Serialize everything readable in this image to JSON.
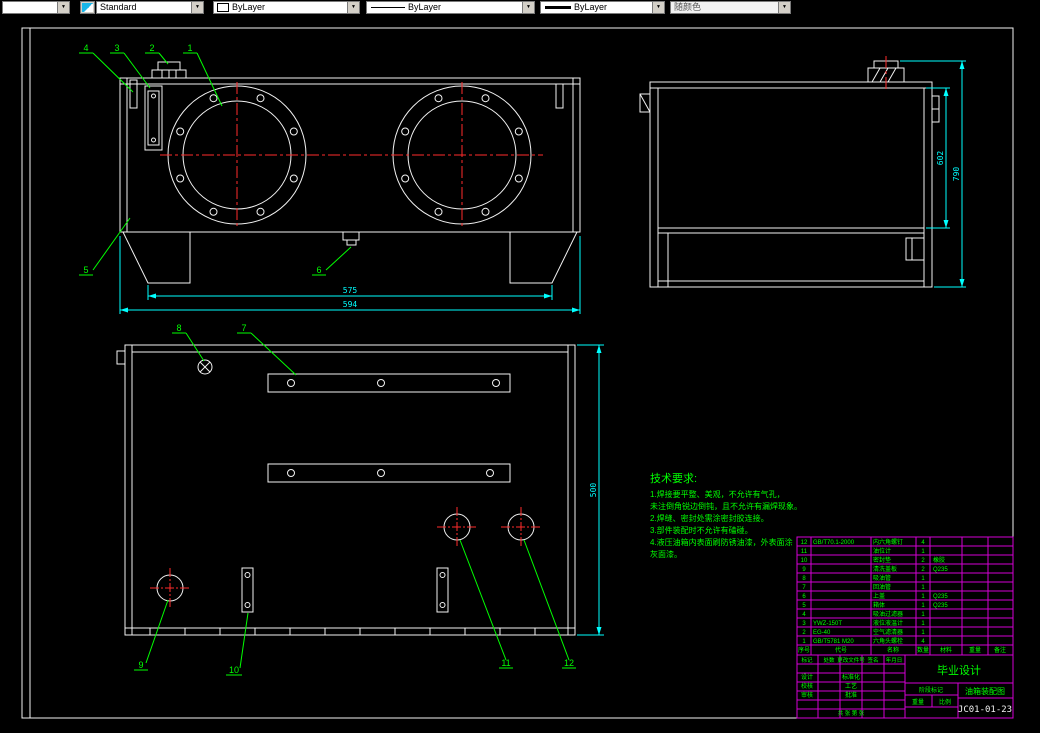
{
  "toolbar": {
    "combos": [
      {
        "value": ""
      },
      {
        "value": "Standard"
      },
      {
        "value": "ByLayer"
      },
      {
        "value": "ByLayer"
      },
      {
        "value": "ByLayer"
      },
      {
        "value": "随颜色"
      }
    ]
  },
  "callouts": [
    "1",
    "2",
    "3",
    "4",
    "5",
    "6",
    "7",
    "8",
    "9",
    "10",
    "11",
    "12"
  ],
  "dims": {
    "front_inner": "575",
    "front_outer": "594",
    "side_inner": "602",
    "side_outer": "790",
    "bottom_height": "500"
  },
  "tech_requirements": {
    "title": "技术要求:",
    "lines": [
      "1.焊接要平整、美观，不允许有气孔，",
      "未注倒角锐边倒钝，且不允许有漏焊现象。",
      "2.焊缝、密封处需涂密封胶连接。",
      "3.部件装配时不允许有磕碰。",
      "4.液压油箱内表面刷防锈油漆，外表面涂",
      "灰面漆。"
    ]
  },
  "title_block": {
    "parts_header": {
      "no": "序号",
      "code": "代号",
      "name": "名称",
      "qty": "数量",
      "material": "材料",
      "weight": "重量",
      "note": "备注"
    },
    "parts": [
      {
        "no": "12",
        "code": "GB/T70.1-2000",
        "name": "内六角螺钉",
        "qty": "4",
        "material": ""
      },
      {
        "no": "11",
        "code": "",
        "name": "油位计",
        "qty": "1",
        "material": ""
      },
      {
        "no": "10",
        "code": "",
        "name": "密封垫",
        "qty": "2",
        "material": "橡胶"
      },
      {
        "no": "9",
        "code": "",
        "name": "清洗盖板",
        "qty": "2",
        "material": "Q235"
      },
      {
        "no": "8",
        "code": "",
        "name": "吸油管",
        "qty": "1",
        "material": ""
      },
      {
        "no": "7",
        "code": "",
        "name": "回油管",
        "qty": "1",
        "material": ""
      },
      {
        "no": "6",
        "code": "",
        "name": "上盖",
        "qty": "1",
        "material": "Q235"
      },
      {
        "no": "5",
        "code": "",
        "name": "箱体",
        "qty": "1",
        "material": "Q235"
      },
      {
        "no": "4",
        "code": "",
        "name": "吸油过滤器",
        "qty": "1",
        "material": ""
      },
      {
        "no": "3",
        "code": "YWZ-150T",
        "name": "液位液温计",
        "qty": "1",
        "material": ""
      },
      {
        "no": "2",
        "code": "EG-40",
        "name": "空气滤清器",
        "qty": "1",
        "material": ""
      },
      {
        "no": "1",
        "code": "GB/T5781 M20",
        "name": "六角头螺栓",
        "qty": "4",
        "material": ""
      }
    ],
    "rev_row": {
      "c0": "标记",
      "c1": "处数",
      "c2": "更改文件号",
      "c3": "签名",
      "c4": "年月日"
    },
    "sig": {
      "design": "设计",
      "standard": "标准化",
      "check": "校核",
      "process": "工艺",
      "audit": "审核",
      "approve": "批准"
    },
    "stage": "阶段标记",
    "weight": "重量",
    "scale": "比例",
    "sheet": "共 张 第 张",
    "project": "毕业设计",
    "drawing_title": "油箱装配图",
    "drawing_no": "JC01-01-23"
  }
}
